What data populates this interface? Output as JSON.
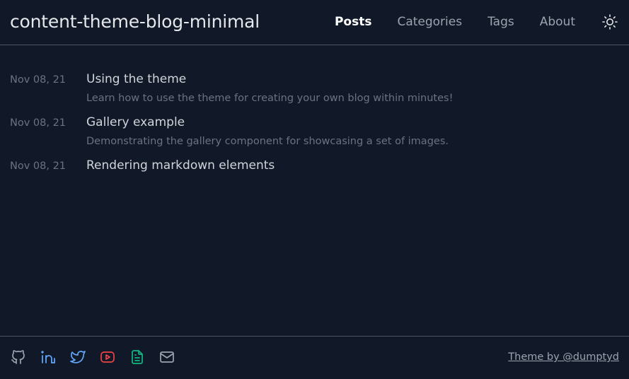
{
  "site": {
    "title": "content-theme-blog-minimal"
  },
  "nav": {
    "items": [
      {
        "label": "Posts",
        "active": true
      },
      {
        "label": "Categories",
        "active": false
      },
      {
        "label": "Tags",
        "active": false
      },
      {
        "label": "About",
        "active": false
      }
    ],
    "theme_toggle_icon": "sun-icon"
  },
  "posts": [
    {
      "date": "Nov 08, 21",
      "title": "Using the theme",
      "description": "Learn how to use the theme for creating your own blog within minutes!"
    },
    {
      "date": "Nov 08, 21",
      "title": "Gallery example",
      "description": "Demonstrating the gallery component for showcasing a set of images."
    },
    {
      "date": "Nov 08, 21",
      "title": "Rendering markdown elements",
      "description": ""
    }
  ],
  "footer": {
    "socials": [
      {
        "icon": "github-icon",
        "color": "#9ca3af"
      },
      {
        "icon": "linkedin-icon",
        "color": "#60a5fa"
      },
      {
        "icon": "twitter-icon",
        "color": "#60a5fa"
      },
      {
        "icon": "youtube-icon",
        "color": "#ef4444"
      },
      {
        "icon": "document-icon",
        "color": "#10b981"
      },
      {
        "icon": "mail-icon",
        "color": "#9ca3af"
      }
    ],
    "credit": "Theme by @dumptyd"
  },
  "colors": {
    "background": "#111827",
    "border": "#4b5563",
    "text_primary": "#e5e7eb",
    "text_muted": "#6b7280"
  }
}
